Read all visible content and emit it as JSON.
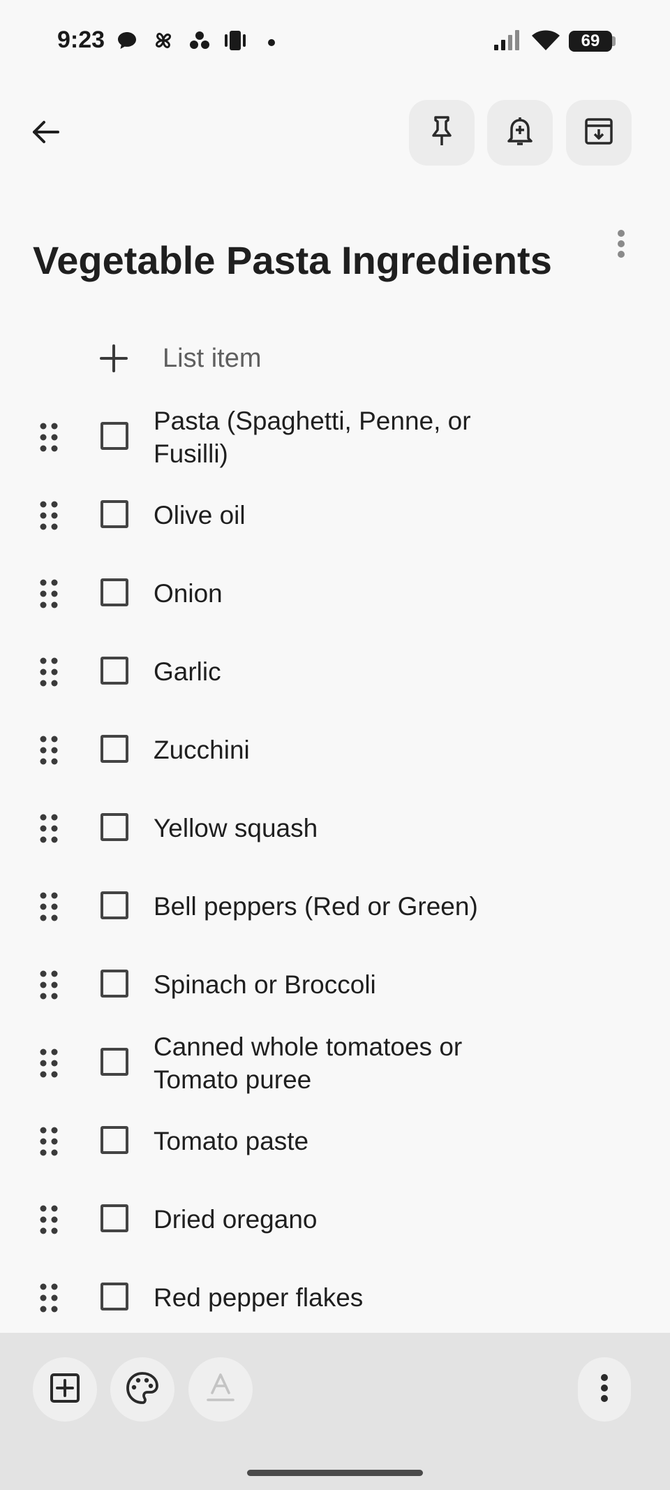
{
  "status": {
    "time": "9:23",
    "battery": "69",
    "icons": [
      "chat-icon",
      "pinwheel-icon",
      "dots-cluster-icon",
      "vibrate-icon",
      "notification-dot-icon",
      "signal-icon",
      "wifi-icon",
      "battery-icon"
    ]
  },
  "toolbar": {
    "back_icon": "arrow-back-icon",
    "pin_icon": "pin-icon",
    "reminder_icon": "bell-add-icon",
    "archive_icon": "archive-icon",
    "more_icon": "more-vert-icon"
  },
  "note": {
    "title": "Vegetable Pasta Ingredients",
    "add_item_label": "List item",
    "items": [
      {
        "text": "Pasta (Spaghetti, Penne, or Fusilli)",
        "checked": false
      },
      {
        "text": "Olive oil",
        "checked": false
      },
      {
        "text": "Onion",
        "checked": false
      },
      {
        "text": "Garlic",
        "checked": false
      },
      {
        "text": "Zucchini",
        "checked": false
      },
      {
        "text": "Yellow squash",
        "checked": false
      },
      {
        "text": "Bell peppers (Red or Green)",
        "checked": false
      },
      {
        "text": "Spinach or Broccoli",
        "checked": false
      },
      {
        "text": "Canned whole tomatoes or Tomato puree",
        "checked": false
      },
      {
        "text": "Tomato paste",
        "checked": false
      },
      {
        "text": "Dried oregano",
        "checked": false
      },
      {
        "text": "Red pepper flakes",
        "checked": false
      }
    ]
  },
  "bottom_bar": {
    "add_icon": "add-box-icon",
    "palette_icon": "palette-icon",
    "text_format_icon": "text-format-icon",
    "more_icon": "more-vert-icon"
  },
  "colors": {
    "background": "#f8f8f8",
    "bottom_bar": "#e3e3e3",
    "button_bg": "#ececec",
    "text": "#1f1f1f",
    "muted": "#5f5f5f"
  }
}
